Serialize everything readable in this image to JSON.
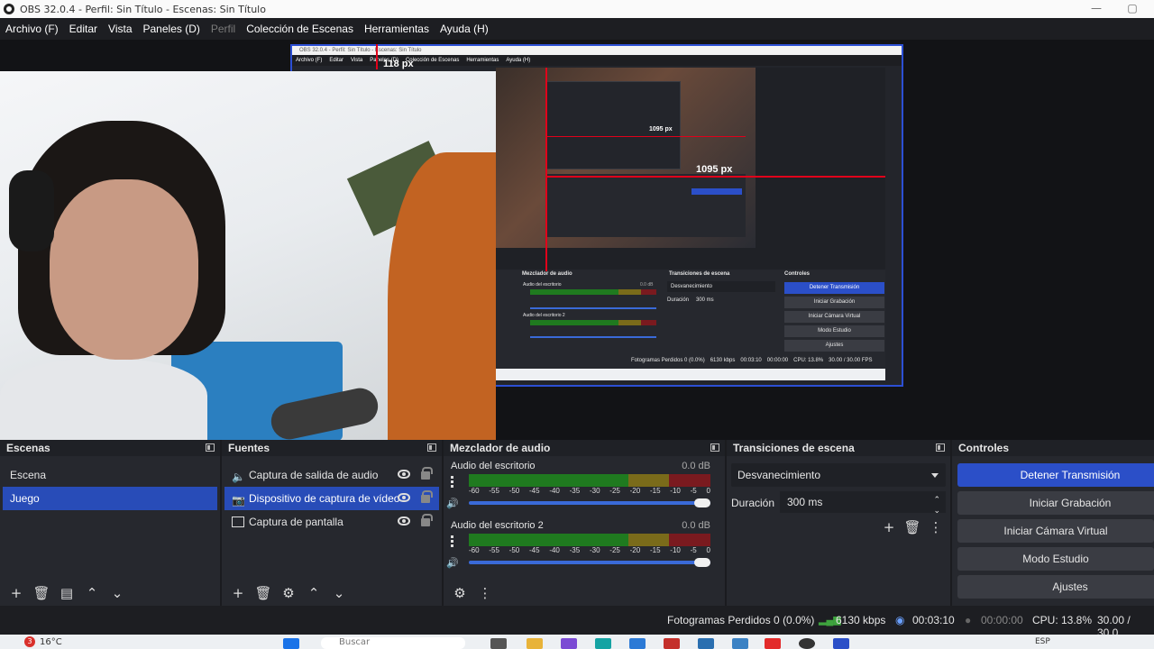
{
  "titlebar": {
    "title": "OBS 32.0.4 - Perfil: Sin Título - Escenas: Sin Título"
  },
  "menu": {
    "items": [
      "Archivo (F)",
      "Editar",
      "Vista",
      "Paneles (D)",
      "Perfil",
      "Colección de Escenas",
      "Herramientas",
      "Ayuda (H)"
    ]
  },
  "preview": {
    "nested_title": "OBS 32.0.4 - Perfil: Sin Título - Escenas: Sin Título",
    "nested_menu": [
      "Archivo (F)",
      "Editar",
      "Vista",
      "Paneles (D)",
      "Colección de Escenas",
      "Herramientas",
      "Ayuda (H)"
    ],
    "measure_top": "118 px",
    "measure_right": "1095 px",
    "measure_right_small": "1095 px",
    "nested_docks": {
      "mixer": "Mezclador de audio",
      "transitions": "Transiciones de escena",
      "controls": "Controles"
    },
    "nested_ch1": "Audio del escritorio",
    "nested_ch2": "Audio del escritorio 2",
    "nested_db": "0.0 dB",
    "nested_transition": "Desvanecimiento",
    "nested_duration_label": "Duración",
    "nested_duration": "300 ms",
    "nested_buttons": [
      "Detener Transmisión",
      "Iniciar Grabación",
      "Iniciar Cámara Virtual",
      "Modo Estudio",
      "Ajustes"
    ],
    "nested_status": {
      "dropped": "Fotogramas Perdidos 0 (0.0%)",
      "kbps": "6130 kbps",
      "time": "00:03:10",
      "rec": "00:00:00",
      "cpu": "CPU: 13.8%",
      "fps": "30.00 / 30.00 FPS"
    }
  },
  "scenes": {
    "title": "Escenas",
    "items": [
      {
        "label": "Escena",
        "selected": false
      },
      {
        "label": "Juego",
        "selected": true
      }
    ]
  },
  "sources": {
    "title": "Fuentes",
    "items": [
      {
        "label": "Captura de salida de audio",
        "icon": "speaker-icon",
        "selected": false
      },
      {
        "label": "Dispositivo de captura de vídeo",
        "icon": "camera-icon",
        "selected": true
      },
      {
        "label": "Captura de pantalla",
        "icon": "monitor-icon",
        "selected": false
      }
    ]
  },
  "mixer": {
    "title": "Mezclador de audio",
    "channels": [
      {
        "name": "Audio del escritorio",
        "db": "0.0 dB"
      },
      {
        "name": "Audio del escritorio 2",
        "db": "0.0 dB"
      }
    ],
    "ticks": [
      "-60",
      "-55",
      "-50",
      "-45",
      "-40",
      "-35",
      "-30",
      "-25",
      "-20",
      "-15",
      "-10",
      "-5",
      "0"
    ]
  },
  "transitions": {
    "title": "Transiciones de escena",
    "selected": "Desvanecimiento",
    "duration_label": "Duración",
    "duration": "300 ms"
  },
  "controls": {
    "title": "Controles",
    "buttons": [
      "Detener Transmisión",
      "Iniciar Grabación",
      "Iniciar Cámara Virtual",
      "Modo Estudio",
      "Ajustes"
    ]
  },
  "status": {
    "dropped": "Fotogramas Perdidos 0 (0.0%)",
    "kbps": "6130 kbps",
    "stream_time": "00:03:10",
    "rec_time": "00:00:00",
    "cpu": "CPU: 13.8%",
    "fps": "30.00 / 30.0"
  },
  "taskbar": {
    "weather_badge": "3",
    "temperature": "16°C",
    "search": "Buscar",
    "lang": "ESP"
  },
  "colors": {
    "accent": "#2b4fc8",
    "selection": "#284cb8",
    "dock_bg": "#26282e",
    "red_guide": "#e0001a"
  }
}
